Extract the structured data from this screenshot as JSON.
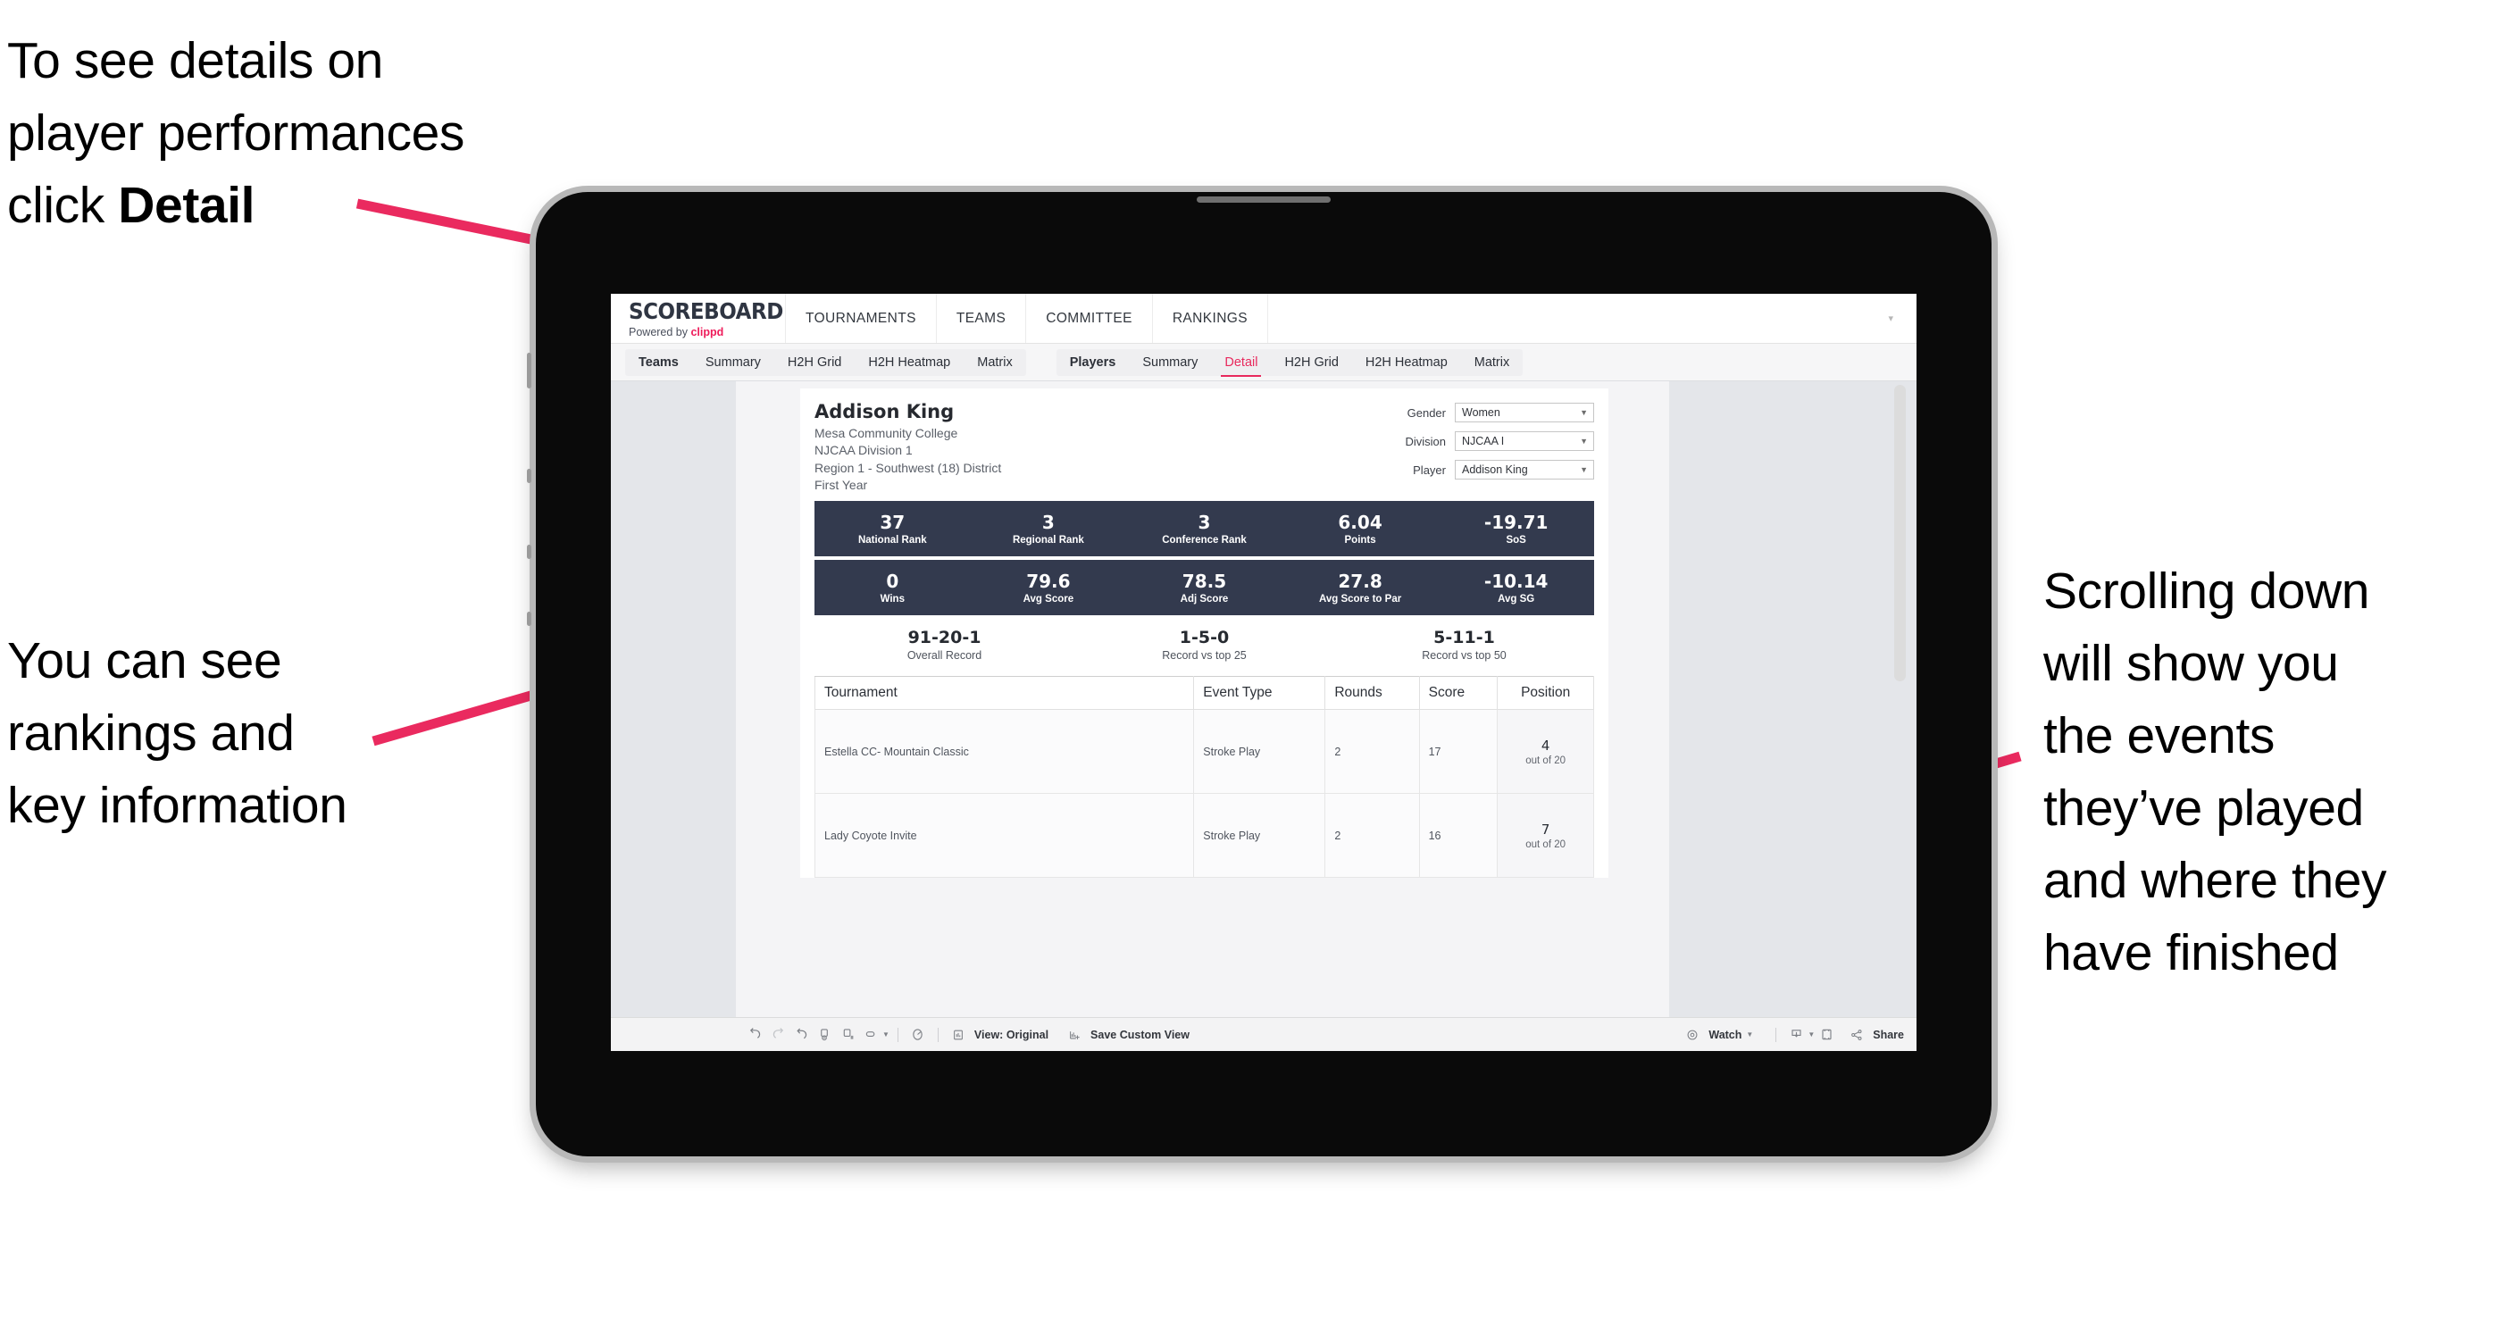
{
  "annotations": {
    "top_left": "To see details on\nplayer performances\nclick ",
    "top_left_bold": "Detail",
    "left": "You can see\nrankings and\nkey information",
    "right": "Scrolling down\nwill show you\nthe events\nthey’ve played\nand where they\nhave finished",
    "arrow_color": "#ea2a5f"
  },
  "app": {
    "brand": {
      "wordmark": "SCOREBOARD",
      "powered_prefix": "Powered by ",
      "powered_brand": "clippd"
    },
    "topnav": [
      "TOURNAMENTS",
      "TEAMS",
      "COMMITTEE",
      "RANKINGS"
    ],
    "tabs_left": [
      "Teams",
      "Summary",
      "H2H Grid",
      "H2H Heatmap",
      "Matrix"
    ],
    "tabs_right": [
      "Players",
      "Summary",
      "Detail",
      "H2H Grid",
      "H2H Heatmap",
      "Matrix"
    ],
    "active_tab": "Detail",
    "accent": "#e8295d",
    "navy": "#333a4e"
  },
  "player": {
    "name": "Addison King",
    "school": "Mesa Community College",
    "division": "NJCAA Division 1",
    "region": "Region 1 - Southwest (18) District",
    "year": "First Year"
  },
  "filters": [
    {
      "label": "Gender",
      "value": "Women"
    },
    {
      "label": "Division",
      "value": "NJCAA I"
    },
    {
      "label": "Player",
      "value": "Addison King"
    }
  ],
  "stats_row1": [
    {
      "value": "37",
      "label": "National Rank"
    },
    {
      "value": "3",
      "label": "Regional Rank"
    },
    {
      "value": "3",
      "label": "Conference Rank"
    },
    {
      "value": "6.04",
      "label": "Points"
    },
    {
      "value": "-19.71",
      "label": "SoS"
    }
  ],
  "stats_row2": [
    {
      "value": "0",
      "label": "Wins"
    },
    {
      "value": "79.6",
      "label": "Avg Score"
    },
    {
      "value": "78.5",
      "label": "Adj Score"
    },
    {
      "value": "27.8",
      "label": "Avg Score to Par"
    },
    {
      "value": "-10.14",
      "label": "Avg SG"
    }
  ],
  "records": [
    {
      "value": "91-20-1",
      "label": "Overall Record"
    },
    {
      "value": "1-5-0",
      "label": "Record vs top 25"
    },
    {
      "value": "5-11-1",
      "label": "Record vs top 50"
    }
  ],
  "events_table": {
    "headers": [
      "Tournament",
      "Event Type",
      "Rounds",
      "Score",
      "Position"
    ],
    "rows": [
      {
        "tournament": "Estella CC- Mountain Classic",
        "event_type": "Stroke Play",
        "rounds": "2",
        "score": "17",
        "position_value": "4",
        "position_label": "out of 20"
      },
      {
        "tournament": "Lady Coyote Invite",
        "event_type": "Stroke Play",
        "rounds": "2",
        "score": "16",
        "position_value": "7",
        "position_label": "out of 20"
      }
    ]
  },
  "toolbar": {
    "view_label": "View: Original",
    "save_label": "Save Custom View",
    "watch_label": "Watch",
    "share_label": "Share"
  }
}
